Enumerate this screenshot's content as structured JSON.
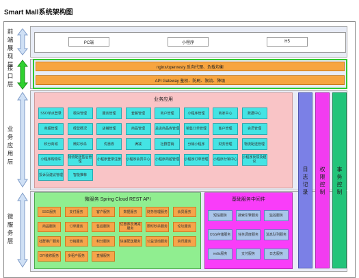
{
  "title": "Smart Mall系统架构图",
  "colors": {
    "frontend_band": "#e8ecf6",
    "interface_band": "#e8ecf6",
    "business_band": "#e8ecf6",
    "business_panel": "#f9c4c6",
    "micro_panel": "#90ee90",
    "base_panel": "#f93df9",
    "orange": "#f6a54a",
    "cyan": "#44e4e4",
    "blue": "#a9c5ea",
    "bar_log": "#7b80e6",
    "bar_monitor": "#f23cf0",
    "bar_tx": "#22c47a"
  },
  "layers": {
    "frontend": "前端展现层",
    "interface": "接口层",
    "business_app": "业务应用层",
    "micro": "微服务层"
  },
  "frontend": {
    "items": [
      "PC端",
      "小程序",
      "H5"
    ]
  },
  "interface": {
    "items": [
      "nginx/openresty 反向代理、负载均衡",
      "API Gateway 鉴权、防刷、限流、降级"
    ]
  },
  "business_app": {
    "title": "业务应用",
    "rows": [
      [
        "SSO单点登录",
        "模块管理",
        "服务管理",
        "套餐管理",
        "商户管理",
        "小程序管理",
        "商家中心",
        "数据中心"
      ],
      [
        "商超管理",
        "经营概况",
        "店铺管理",
        "商品管理",
        "总店商品库管理",
        "销售订单管理",
        "客户管理",
        "会员管理"
      ],
      [
        "积分商城",
        "微好秒杀",
        "优惠券",
        "满减",
        "社群营销",
        "分销小程序",
        "财务管理",
        "物流配送管理"
      ],
      [
        "小程序购物车",
        "物流配送售后管理",
        "小程序登录注册",
        "小程序会员中心",
        "小程序商超管理",
        "小程序订单管理",
        "小程序分销中心",
        "小程序反馈及建议"
      ],
      [
        "投诉及建议管理",
        "智能推荐"
      ]
    ]
  },
  "micro": {
    "title": "微服务 Spring Cloud REST API",
    "rows": [
      [
        "SSO服务",
        "支付服务",
        "客户服务",
        "数据服务",
        "财务管理服务",
        "会员服务"
      ],
      [
        "商品服务",
        "订单服务",
        "售后服务",
        "优惠券及满减服务",
        "限时秒杀服务",
        "论坛服务"
      ],
      [
        "社群推广服务",
        "分销服务",
        "积分服务",
        "快递配送服务",
        "公益活动服务",
        "资讯服务"
      ],
      [
        "DIY装修服务",
        "多租户服务",
        "直播服务"
      ]
    ]
  },
  "base": {
    "title": "基础服务中间件",
    "rows": [
      [
        "短信服务",
        "搜索引擎服务",
        "监控服务"
      ],
      [
        "OSS存储服务",
        "任务调度服务",
        "消息队列服务"
      ],
      [
        "redis服务",
        "支付服务",
        "日志服务"
      ]
    ]
  },
  "sidebars": [
    "日志记录",
    "权限控制",
    "事务控制"
  ]
}
